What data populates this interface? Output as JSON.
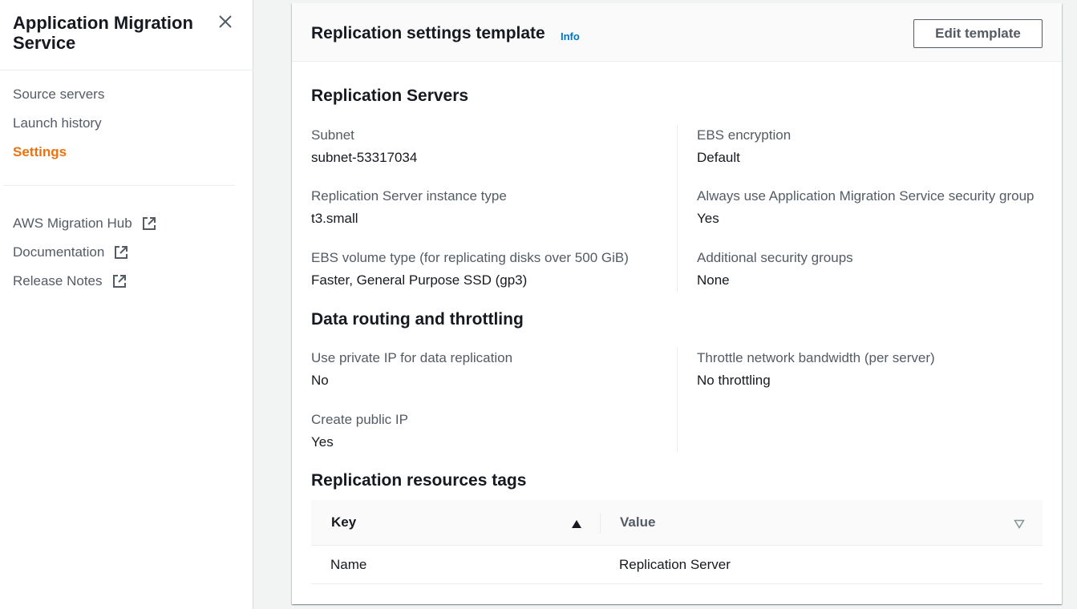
{
  "sidebar": {
    "title": "Application Migration Service",
    "nav": [
      {
        "label": "Source servers",
        "active": false
      },
      {
        "label": "Launch history",
        "active": false
      },
      {
        "label": "Settings",
        "active": true
      }
    ],
    "external_links": [
      {
        "label": "AWS Migration Hub",
        "icon": "external-link-icon"
      },
      {
        "label": "Documentation",
        "icon": "external-link-icon"
      },
      {
        "label": "Release Notes",
        "icon": "external-link-icon"
      }
    ]
  },
  "panel": {
    "title": "Replication settings template",
    "info": "Info",
    "edit_button": "Edit template"
  },
  "replication_servers": {
    "title": "Replication Servers",
    "left": [
      {
        "label": "Subnet",
        "value": "subnet-53317034"
      },
      {
        "label": "Replication Server instance type",
        "value": "t3.small"
      },
      {
        "label": "EBS volume type (for replicating disks over 500 GiB)",
        "value": "Faster, General Purpose SSD (gp3)"
      }
    ],
    "right": [
      {
        "label": "EBS encryption",
        "value": "Default"
      },
      {
        "label": "Always use Application Migration Service security group",
        "value": "Yes"
      },
      {
        "label": "Additional security groups",
        "value": "None"
      }
    ]
  },
  "data_routing": {
    "title": "Data routing and throttling",
    "left": [
      {
        "label": "Use private IP for data replication",
        "value": "No"
      },
      {
        "label": "Create public IP",
        "value": "Yes"
      }
    ],
    "right": [
      {
        "label": "Throttle network bandwidth (per server)",
        "value": "No throttling"
      }
    ]
  },
  "tags": {
    "title": "Replication resources tags",
    "columns": [
      "Key",
      "Value"
    ],
    "sort": {
      "column": "Key",
      "direction": "ascending"
    },
    "rows": [
      {
        "key": "Name",
        "value": "Replication Server"
      }
    ]
  },
  "colors": {
    "accent": "#ec7211",
    "link": "#0073bb",
    "text": "#16191f",
    "muted": "#545b64"
  }
}
